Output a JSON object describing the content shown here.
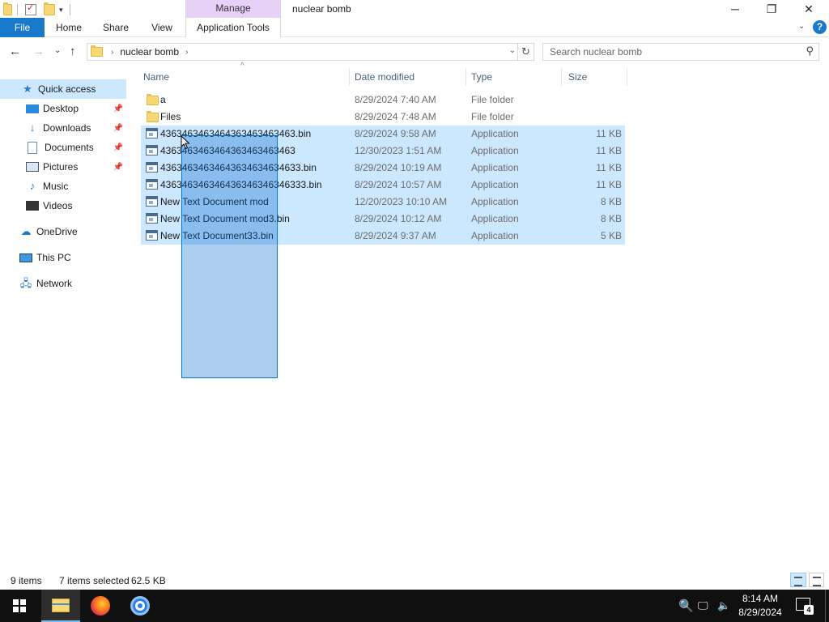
{
  "window": {
    "title": "nuclear bomb",
    "context_tab": "Manage",
    "controls": {
      "minimize": "─",
      "maximize": "❐",
      "close": "✕"
    }
  },
  "ribbon": {
    "tabs": [
      "File",
      "Home",
      "Share",
      "View",
      "Application Tools"
    ],
    "help_label": "?"
  },
  "address": {
    "segments": [
      "nuclear bomb"
    ],
    "search_placeholder": "Search nuclear bomb"
  },
  "nav_pane": {
    "items": [
      {
        "label": "Quick access",
        "icon": "star-icon",
        "pinned": false,
        "selected": true
      },
      {
        "label": "Desktop",
        "icon": "desktop-icon",
        "pinned": true
      },
      {
        "label": "Downloads",
        "icon": "download-arrow-icon",
        "pinned": true
      },
      {
        "label": "Documents",
        "icon": "document-icon",
        "pinned": true
      },
      {
        "label": "Pictures",
        "icon": "pictures-icon",
        "pinned": true
      },
      {
        "label": "Music",
        "icon": "music-note-icon",
        "pinned": false
      },
      {
        "label": "Videos",
        "icon": "video-icon",
        "pinned": false
      },
      {
        "label": "OneDrive",
        "icon": "cloud-icon",
        "pinned": false
      },
      {
        "label": "This PC",
        "icon": "computer-icon",
        "pinned": false
      },
      {
        "label": "Network",
        "icon": "network-icon",
        "pinned": false
      }
    ]
  },
  "columns": {
    "name": "Name",
    "date": "Date modified",
    "type": "Type",
    "size": "Size"
  },
  "files": [
    {
      "name": "a",
      "date": "8/29/2024 7:40 AM",
      "type": "File folder",
      "size": "",
      "kind": "folder",
      "selected": false
    },
    {
      "name": "Files",
      "date": "8/29/2024 7:48 AM",
      "type": "File folder",
      "size": "",
      "kind": "folder",
      "selected": false
    },
    {
      "name": "4363463463464363463463463.bin",
      "date": "8/29/2024 9:58 AM",
      "type": "Application",
      "size": "11 KB",
      "kind": "app",
      "selected": true
    },
    {
      "name": "4363463463464363463463463",
      "date": "12/30/2023 1:51 AM",
      "type": "Application",
      "size": "11 KB",
      "kind": "app",
      "selected": true
    },
    {
      "name": "43634634634643634634634633.bin",
      "date": "8/29/2024 10:19 AM",
      "type": "Application",
      "size": "11 KB",
      "kind": "app",
      "selected": true
    },
    {
      "name": "436346346346436346346346333.bin",
      "date": "8/29/2024 10:57 AM",
      "type": "Application",
      "size": "11 KB",
      "kind": "app",
      "selected": true
    },
    {
      "name": "New Text Document mod",
      "date": "12/20/2023 10:10 AM",
      "type": "Application",
      "size": "8 KB",
      "kind": "app",
      "selected": true
    },
    {
      "name": "New Text Document mod3.bin",
      "date": "8/29/2024 10:12 AM",
      "type": "Application",
      "size": "8 KB",
      "kind": "app",
      "selected": true
    },
    {
      "name": "New Text Document33.bin",
      "date": "8/29/2024 9:37 AM",
      "type": "Application",
      "size": "5 KB",
      "kind": "app",
      "selected": true
    }
  ],
  "status": {
    "item_count": "9 items",
    "selection": "7 items selected",
    "selection_size": "62.5 KB"
  },
  "taskbar": {
    "pinned": [
      "windows-start-icon",
      "file-explorer-icon",
      "firefox-icon",
      "chrome-icon"
    ],
    "clock_time": "8:14 AM",
    "clock_date": "8/29/2024",
    "notification_count": "4"
  }
}
